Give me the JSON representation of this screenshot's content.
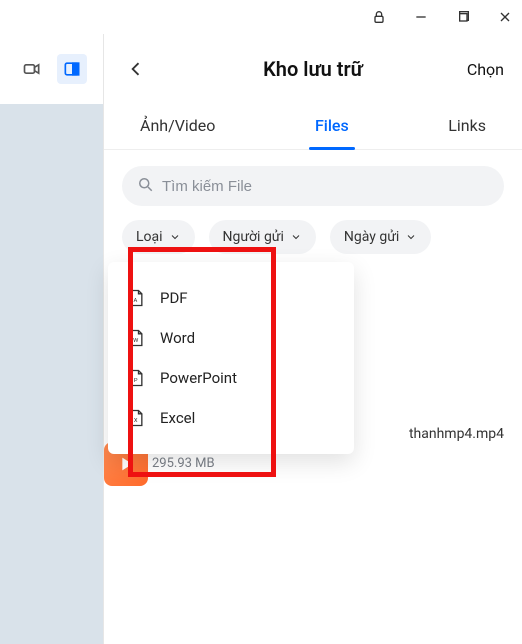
{
  "window": {
    "lock_icon": "lock",
    "minimize_icon": "minimize",
    "restore_icon": "restore",
    "close_icon": "close"
  },
  "sidebar": {
    "video_icon": "video",
    "panel_icon": "panel"
  },
  "header": {
    "title": "Kho lưu trữ",
    "select_label": "Chọn"
  },
  "tabs": {
    "items": [
      {
        "label": "Ảnh/Video",
        "active": false
      },
      {
        "label": "Files",
        "active": true
      },
      {
        "label": "Links",
        "active": false
      }
    ]
  },
  "search": {
    "placeholder": "Tìm kiếm File"
  },
  "filters": {
    "type_label": "Loại",
    "sender_label": "Người gửi",
    "date_label": "Ngày gửi"
  },
  "type_dropdown": {
    "items": [
      {
        "icon": "pdf",
        "label": "PDF"
      },
      {
        "icon": "word",
        "label": "Word"
      },
      {
        "icon": "ppt",
        "label": "PowerPoint"
      },
      {
        "icon": "xls",
        "label": "Excel"
      }
    ]
  },
  "file_row": {
    "name": "thanhmp4.mp4",
    "size": "295.93 MB"
  }
}
